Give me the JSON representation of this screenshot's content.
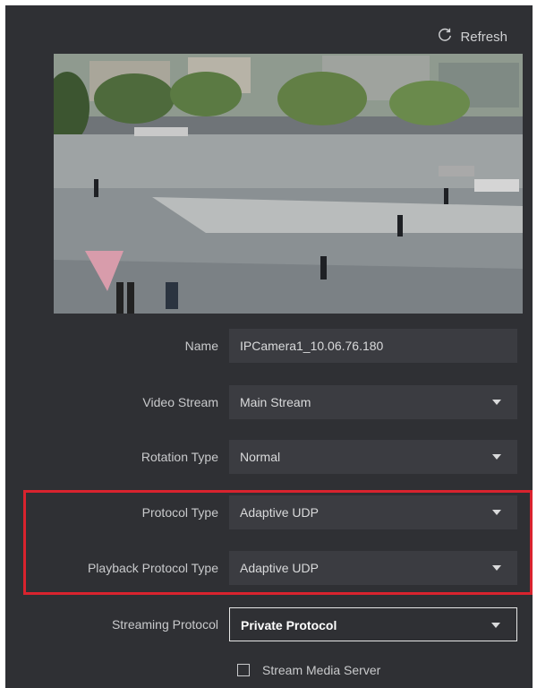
{
  "toolbar": {
    "refresh_label": "Refresh"
  },
  "form": {
    "name": {
      "label": "Name",
      "value": "IPCamera1_10.06.76.180"
    },
    "video_stream": {
      "label": "Video Stream",
      "value": "Main Stream"
    },
    "rotation_type": {
      "label": "Rotation Type",
      "value": "Normal"
    },
    "protocol_type": {
      "label": "Protocol Type",
      "value": "Adaptive UDP"
    },
    "playback_protocol_type": {
      "label": "Playback Protocol Type",
      "value": "Adaptive UDP"
    },
    "streaming_protocol": {
      "label": "Streaming Protocol",
      "value": "Private Protocol"
    },
    "stream_media_server": {
      "label": "Stream Media Server",
      "checked": false
    }
  },
  "colors": {
    "panel_bg": "#2f3034",
    "field_bg": "#3b3c41",
    "highlight": "#d9232e"
  },
  "icons": {
    "refresh": "refresh-icon",
    "dropdown": "chevron-down-icon"
  }
}
